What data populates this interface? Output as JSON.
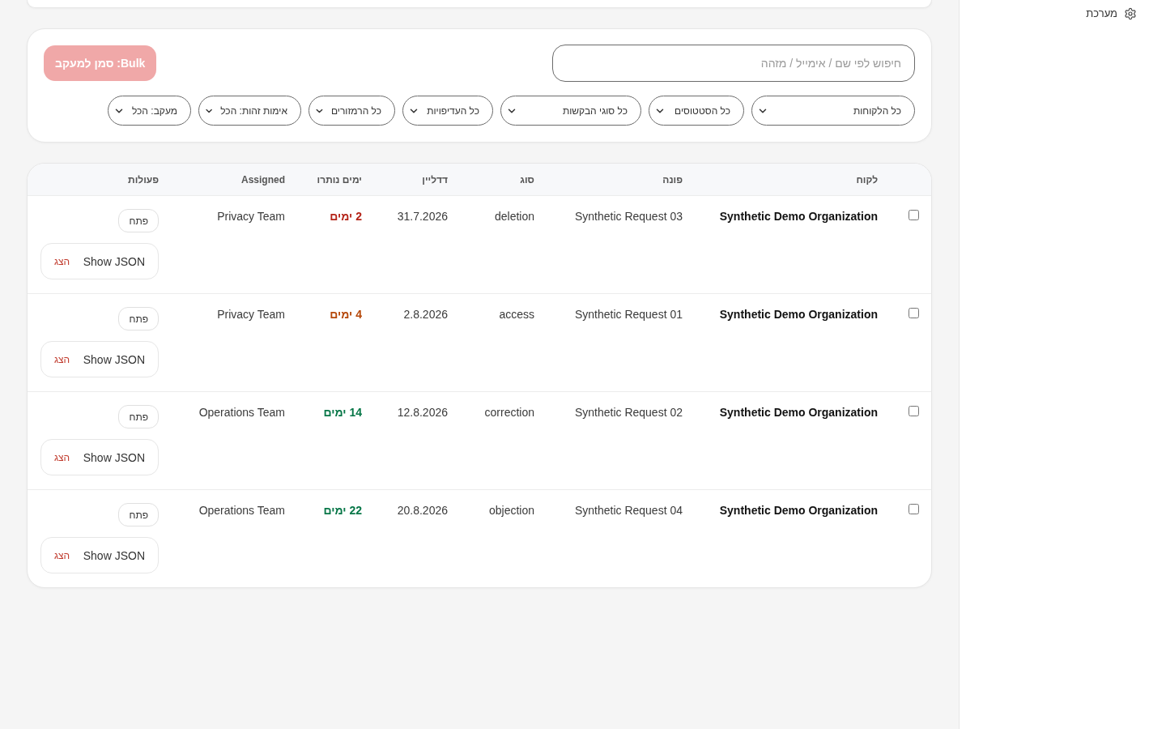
{
  "sidebar": {
    "items": [
      {
        "label": "מערכת"
      }
    ]
  },
  "filters": {
    "search": {
      "placeholder": "חיפוש לפי שם / אימייל / מזהה"
    },
    "bulk_button": {
      "label": "Bulk: סמן למעקב",
      "disabled": true
    },
    "selects": [
      {
        "value": "כל הלקוחות"
      },
      {
        "value": "כל הסטטוסים"
      },
      {
        "value": "כל סוגי הבקשות"
      },
      {
        "value": "כל העדיפויות"
      },
      {
        "value": "כל הרמזורים"
      },
      {
        "value": "אימות זהות: הכל"
      },
      {
        "value": "מעקב: הכל"
      }
    ]
  },
  "table": {
    "columns": [
      "לקוח",
      "פונה",
      "סוג",
      "דדליין",
      "ימים נותרו",
      "Assigned",
      "פעולות"
    ],
    "rows": [
      {
        "checked": false,
        "customer": "Synthetic Demo Organization",
        "requester": "Synthetic Request 03",
        "type": "deletion",
        "deadline": "31.7.2026",
        "days_left": {
          "text": "2 ימים",
          "color": "#b42318"
        },
        "assigned": "Privacy Team",
        "actions": [
          {
            "kind": "open",
            "label": "פתח"
          },
          {
            "kind": "json",
            "label": "Show JSON",
            "hint": "הצג"
          }
        ]
      },
      {
        "checked": false,
        "customer": "Synthetic Demo Organization",
        "requester": "Synthetic Request 01",
        "type": "access",
        "deadline": "2.8.2026",
        "days_left": {
          "text": "4 ימים",
          "color": "#b54708"
        },
        "assigned": "Privacy Team",
        "actions": [
          {
            "kind": "open",
            "label": "פתח"
          },
          {
            "kind": "json",
            "label": "Show JSON",
            "hint": "הצג"
          }
        ]
      },
      {
        "checked": false,
        "customer": "Synthetic Demo Organization",
        "requester": "Synthetic Request 02",
        "type": "correction",
        "deadline": "12.8.2026",
        "days_left": {
          "text": "14 ימים",
          "color": "#067647"
        },
        "assigned": "Operations Team",
        "actions": [
          {
            "kind": "open",
            "label": "פתח"
          },
          {
            "kind": "json",
            "label": "Show JSON",
            "hint": "הצג"
          }
        ]
      },
      {
        "checked": false,
        "customer": "Synthetic Demo Organization",
        "requester": "Synthetic Request 04",
        "type": "objection",
        "deadline": "20.8.2026",
        "days_left": {
          "text": "22 ימים",
          "color": "#067647"
        },
        "assigned": "Operations Team",
        "actions": [
          {
            "kind": "open",
            "label": "פתח"
          },
          {
            "kind": "json",
            "label": "Show JSON",
            "hint": "הצג"
          }
        ]
      }
    ]
  }
}
